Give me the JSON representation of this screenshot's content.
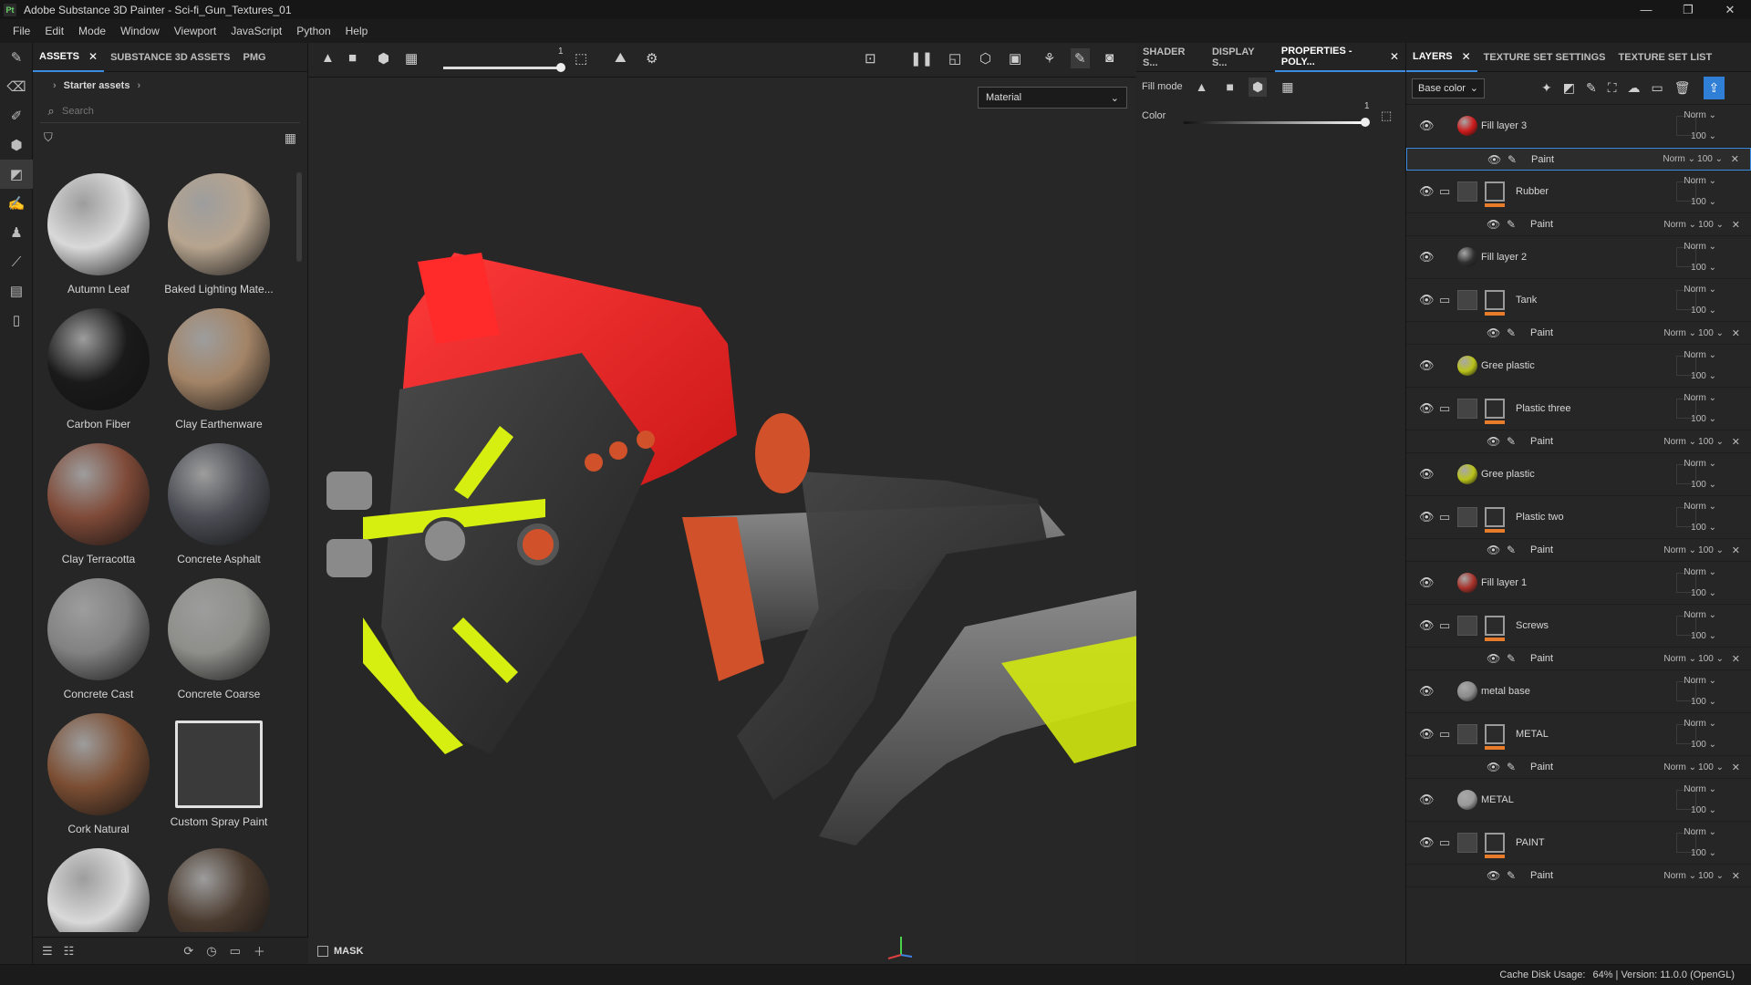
{
  "window": {
    "title": "Adobe Substance 3D Painter - Sci-fi_Gun_Textures_01",
    "badge": "Pt",
    "minimize": "—",
    "restore": "❐",
    "close": "✕"
  },
  "menu": [
    "File",
    "Edit",
    "Mode",
    "Window",
    "Viewport",
    "JavaScript",
    "Python",
    "Help"
  ],
  "assets_panel": {
    "tabs": [
      {
        "label": "ASSETS",
        "close": "✕"
      },
      {
        "label": "SUBSTANCE 3D ASSETS"
      },
      {
        "label": "PMG"
      }
    ],
    "breadcrumb": "Starter assets",
    "search_placeholder": "Search",
    "items": [
      {
        "label": "Autumn Leaf",
        "color": "#d9d9d9"
      },
      {
        "label": "Baked Lighting Mate...",
        "color": "#b6a48f"
      },
      {
        "label": "Carbon Fiber",
        "color": "#1a1a1a"
      },
      {
        "label": "Clay Earthenware",
        "color": "#a38467"
      },
      {
        "label": "Clay Terracotta",
        "color": "#7f4a38"
      },
      {
        "label": "Concrete Asphalt",
        "color": "#4c4e55"
      },
      {
        "label": "Concrete Cast",
        "color": "#828282"
      },
      {
        "label": "Concrete Coarse",
        "color": "#8e8e8a"
      },
      {
        "label": "Cork Natural",
        "color": "#7b4e33"
      },
      {
        "label": "Custom Spray Paint",
        "color": "#3a3a3a"
      },
      {
        "label": "",
        "color": "#d9d9d9"
      },
      {
        "label": "",
        "color": "#4a3a2e"
      }
    ]
  },
  "viewport": {
    "slider_value": "1",
    "material_mode": "Material",
    "mask_label": "MASK"
  },
  "properties_panel": {
    "tabs": [
      {
        "label": "SHADER S..."
      },
      {
        "label": "DISPLAY S..."
      },
      {
        "label": "PROPERTIES - POLY...",
        "close": "✕"
      }
    ],
    "fill_mode_label": "Fill mode",
    "color_label": "Color",
    "color_value": "1"
  },
  "layers_panel": {
    "tabs": [
      {
        "label": "LAYERS",
        "close": "✕"
      },
      {
        "label": "TEXTURE SET SETTINGS"
      },
      {
        "label": "TEXTURE SET LIST"
      }
    ],
    "channel": "Base color",
    "layers": [
      {
        "name": "Fill layer 3",
        "kind": "fill",
        "thumb": "#cc1a1a",
        "norm": "Norm",
        "opacity": "100",
        "sub": {
          "name": "Paint",
          "norm": "Norm",
          "opacity": "100"
        }
      },
      {
        "name": "Rubber",
        "kind": "folder",
        "norm": "Norm",
        "opacity": "100",
        "sub": {
          "name": "Paint",
          "norm": "Norm",
          "opacity": "100"
        }
      },
      {
        "name": "Fill layer 2",
        "kind": "fill",
        "thumb": "#303030",
        "norm": "Norm",
        "opacity": "100"
      },
      {
        "name": "Tank",
        "kind": "folder",
        "norm": "Norm",
        "opacity": "100",
        "sub": {
          "name": "Paint",
          "norm": "Norm",
          "opacity": "100"
        }
      },
      {
        "name": "Gree plastic",
        "kind": "fill",
        "thumb": "#b9c21a",
        "norm": "Norm",
        "opacity": "100"
      },
      {
        "name": "Plastic three",
        "kind": "folder",
        "norm": "Norm",
        "opacity": "100",
        "sub": {
          "name": "Paint",
          "norm": "Norm",
          "opacity": "100"
        }
      },
      {
        "name": "Gree plastic",
        "kind": "fill",
        "thumb": "#b9c21a",
        "norm": "Norm",
        "opacity": "100"
      },
      {
        "name": "Plastic two",
        "kind": "folder",
        "norm": "Norm",
        "opacity": "100",
        "sub": {
          "name": "Paint",
          "norm": "Norm",
          "opacity": "100"
        }
      },
      {
        "name": "Fill layer 1",
        "kind": "fill",
        "thumb": "#a8312a",
        "norm": "Norm",
        "opacity": "100"
      },
      {
        "name": "Screws",
        "kind": "folder",
        "norm": "Norm",
        "opacity": "100",
        "sub": {
          "name": "Paint",
          "norm": "Norm",
          "opacity": "100"
        }
      },
      {
        "name": "metal base",
        "kind": "fill",
        "thumb": "#8c8c8c",
        "norm": "Norm",
        "opacity": "100"
      },
      {
        "name": "METAL",
        "kind": "folder",
        "norm": "Norm",
        "opacity": "100",
        "sub": {
          "name": "Paint",
          "norm": "Norm",
          "opacity": "100"
        }
      },
      {
        "name": "METAL",
        "kind": "fill",
        "thumb": "#9a9a9a",
        "norm": "Norm",
        "opacity": "100"
      },
      {
        "name": "PAINT",
        "kind": "folder",
        "norm": "Norm",
        "opacity": "100",
        "sub": {
          "name": "Paint",
          "norm": "Norm",
          "opacity": "100"
        }
      }
    ]
  },
  "status": {
    "cache": "Cache Disk Usage:",
    "cache_value": "64% | Version: 11.0.0 (OpenGL)"
  }
}
